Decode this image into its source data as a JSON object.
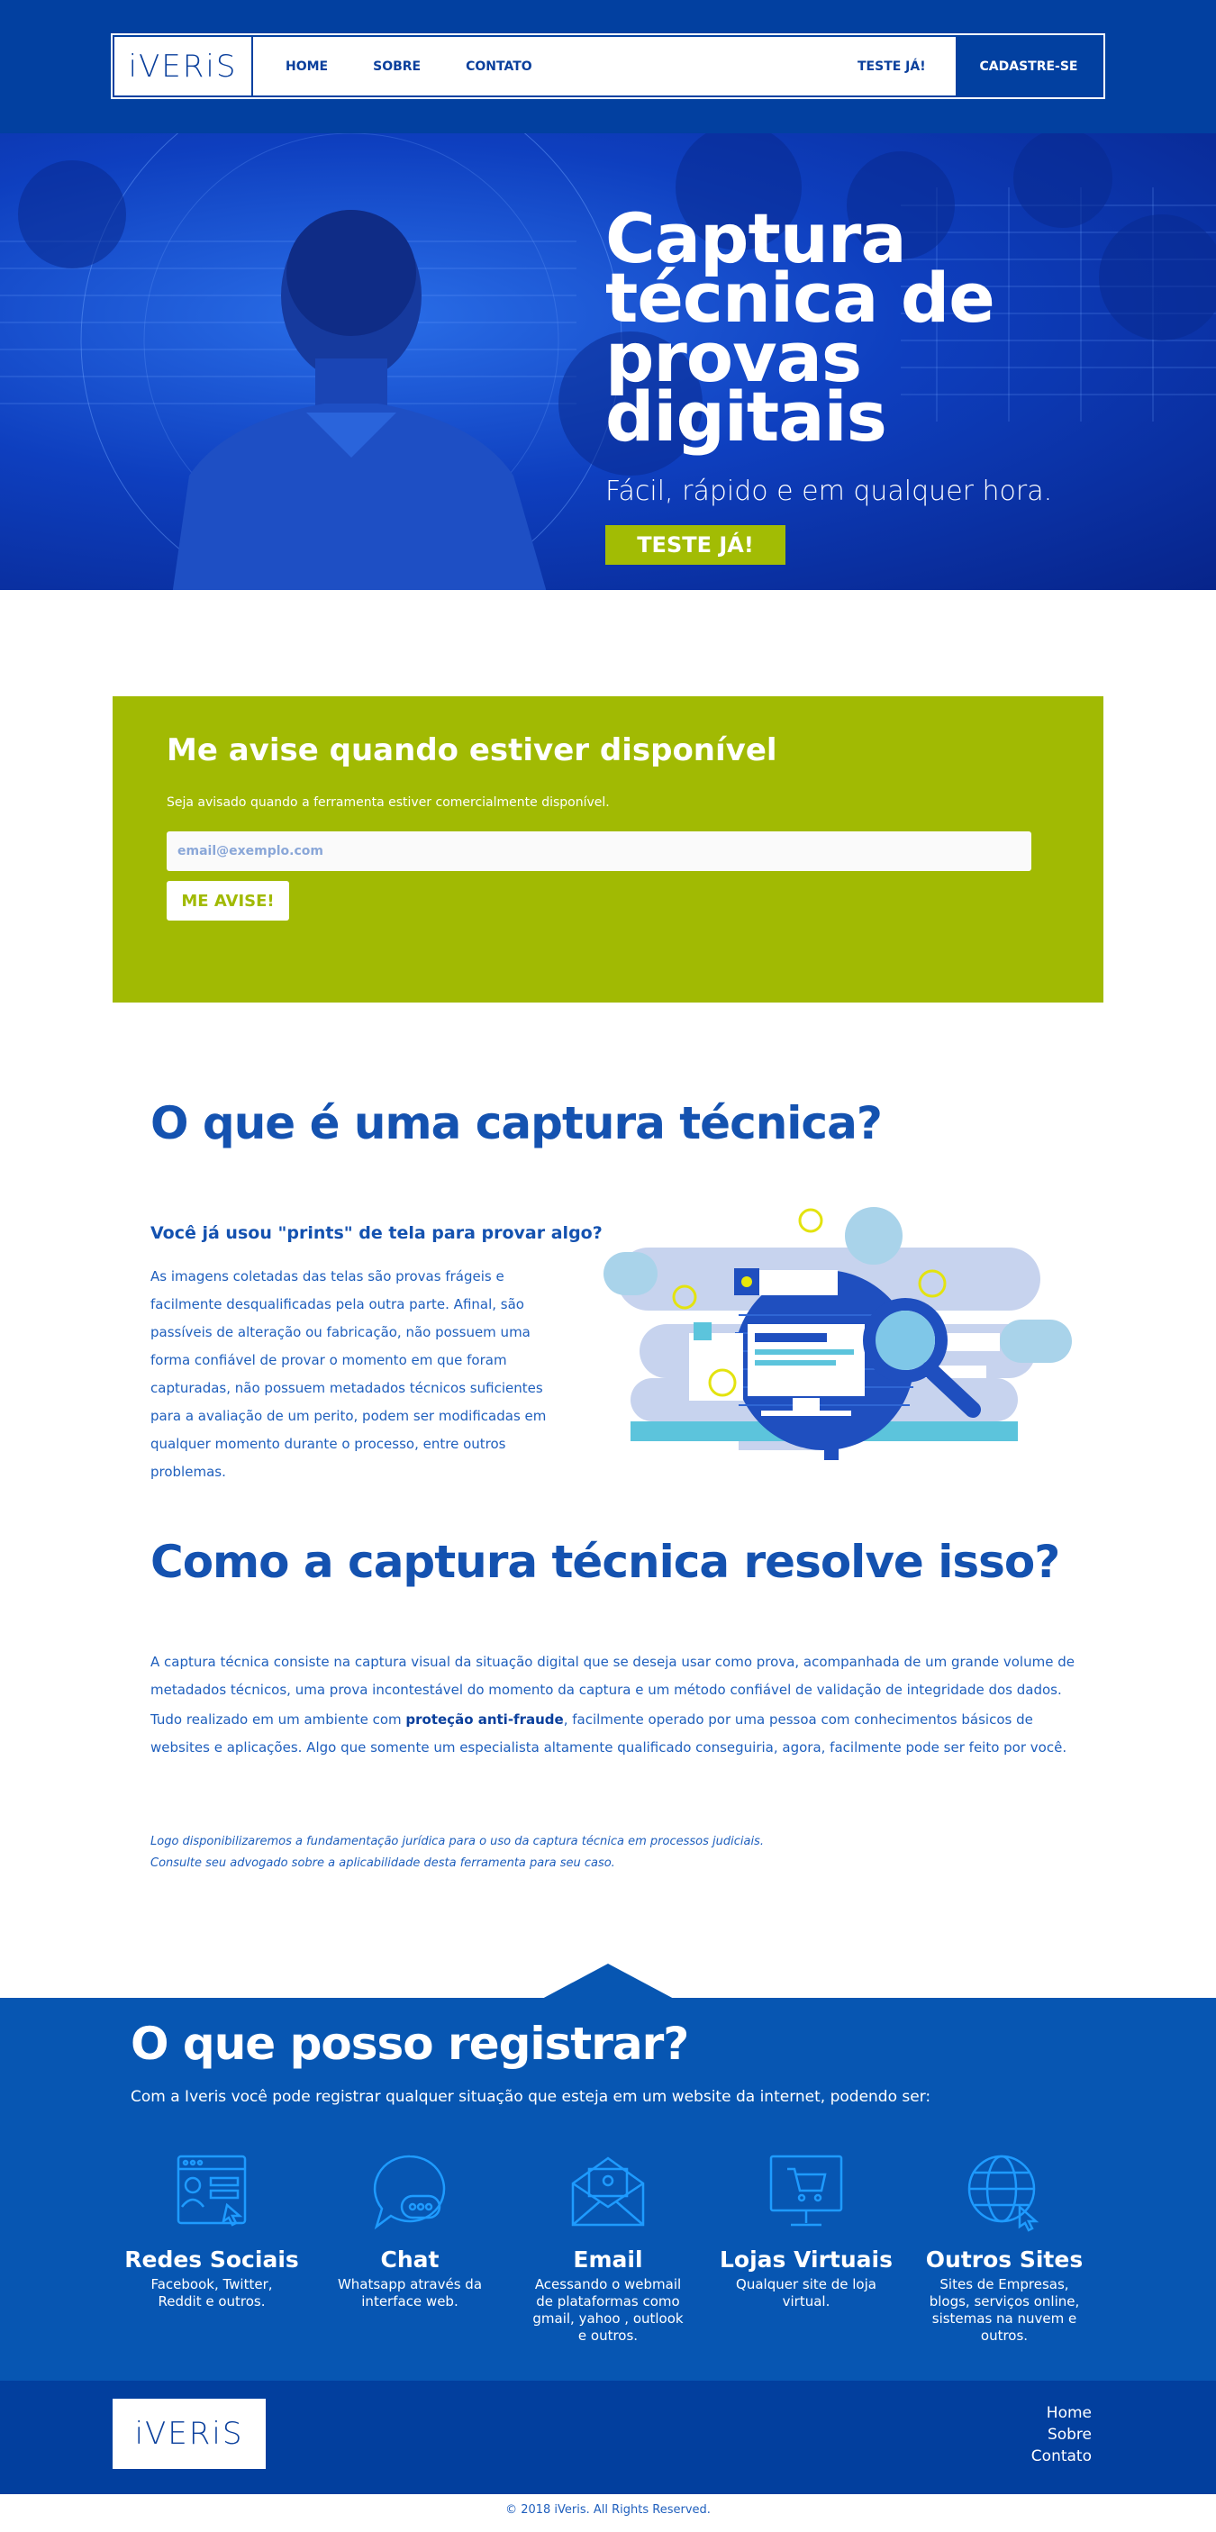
{
  "header": {
    "logo": "iVERiS",
    "nav": [
      "HOME",
      "SOBRE",
      "CONTATO"
    ],
    "try_label": "TESTE JÁ!",
    "cta_label": "CADASTRE-SE"
  },
  "hero": {
    "title_lines": [
      "Captura",
      "técnica de",
      "provas",
      "digitais"
    ],
    "subtitle": "Fácil, rápido e em qualquer hora.",
    "button": "TESTE JÁ!"
  },
  "notify": {
    "title": "Me avise quando estiver disponível",
    "text": "Seja avisado quando a ferramenta estiver comercialmente disponível.",
    "placeholder": "email@exemplo.com",
    "button": "ME AVISE!"
  },
  "what": {
    "title": "O que é uma captura técnica?",
    "question": "Você já usou \"prints\" de tela para provar algo?",
    "body": "As imagens coletadas das telas são provas frágeis e facilmente desqualificadas pela outra parte. Afinal, são passíveis de alteração ou fabricação, não possuem uma forma confiável de provar o momento em que foram capturadas, não possuem metadados técnicos suficientes para a avaliação de um perito, podem ser modificadas em qualquer momento durante o processo, entre outros problemas."
  },
  "solve": {
    "title": "Como a captura técnica resolve isso?",
    "p1": "A captura técnica consiste na captura visual da situação digital que se deseja usar como prova, acompanhada de um grande volume de metadados técnicos, uma prova incontestável do momento da captura e um método confiável de validação de integridade dos dados.",
    "p2_before": "Tudo realizado em um ambiente com ",
    "p2_bold": "proteção anti-fraude",
    "p2_after": ", facilmente operado por uma pessoa com conhecimentos básicos de websites e aplicações. Algo que somente um especialista altamente qualificado conseguiria, agora, facilmente pode ser feito por você.",
    "note1": "Logo disponibilizaremos a fundamentação jurídica para o uso da captura técnica em processos judiciais.",
    "note2": "Consulte seu advogado sobre a aplicabilidade desta ferramenta para seu caso."
  },
  "register": {
    "title": "O que posso registrar?",
    "lead": "Com a Iveris você pode registrar qualquer situação que esteja em um website da internet, podendo ser:",
    "cards": [
      {
        "title": "Redes Sociais",
        "desc": "Facebook, Twitter, Reddit e outros.",
        "icon": "social-network-icon"
      },
      {
        "title": "Chat",
        "desc": "Whatsapp através da interface web.",
        "icon": "chat-bubble-icon"
      },
      {
        "title": "Email",
        "desc": "Acessando o webmail de plataformas como gmail, yahoo , outlook e outros.",
        "icon": "envelope-icon"
      },
      {
        "title": "Lojas Virtuais",
        "desc": "Qualquer site de loja virtual.",
        "icon": "shopping-cart-icon"
      },
      {
        "title": "Outros Sites",
        "desc": "Sites de Empresas, blogs, serviços online, sistemas na nuvem e outros.",
        "icon": "globe-icon"
      }
    ]
  },
  "footer": {
    "logo": "iVERiS",
    "links": [
      "Home",
      "Sobre",
      "Contato"
    ],
    "copyright": "© 2018 iVeris. All Rights Reserved."
  },
  "colors": {
    "primary_blue": "#0240a0",
    "accent_green": "#a1ba03",
    "section_blue": "#0756b2"
  }
}
